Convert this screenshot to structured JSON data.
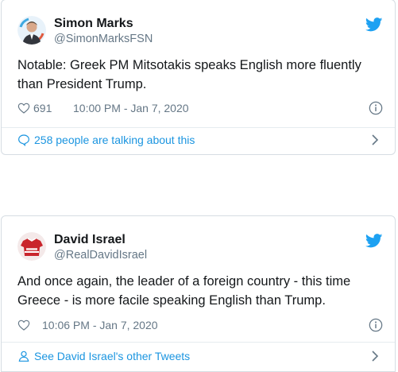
{
  "tweets": [
    {
      "author": "Simon Marks",
      "handle": "@SimonMarksFSN",
      "text": "Notable:  Greek PM Mitsotakis speaks English more fluently than President Trump.",
      "likes": "691",
      "timestamp": "10:00 PM - Jan 7, 2020",
      "footer_text": "258 people are talking about this"
    },
    {
      "author": "David Israel",
      "handle": "@RealDavidIsrael",
      "text": "And once again, the leader of a foreign country - this time Greece - is more facile speaking English than Trump.",
      "likes": "",
      "timestamp": "10:06 PM - Jan 7, 2020",
      "footer_text": "See David Israel's other Tweets"
    }
  ],
  "colors": {
    "twitter_blue": "#1da1f2",
    "link_blue": "#1b95e0",
    "muted_gray": "#657786",
    "border": "#d6dde3"
  },
  "icons": {
    "brand": "twitter-bird-icon",
    "like": "heart-icon",
    "info": "info-icon",
    "comment": "comment-bubble-icon",
    "profile": "person-icon",
    "more": "chevron-right-icon"
  }
}
